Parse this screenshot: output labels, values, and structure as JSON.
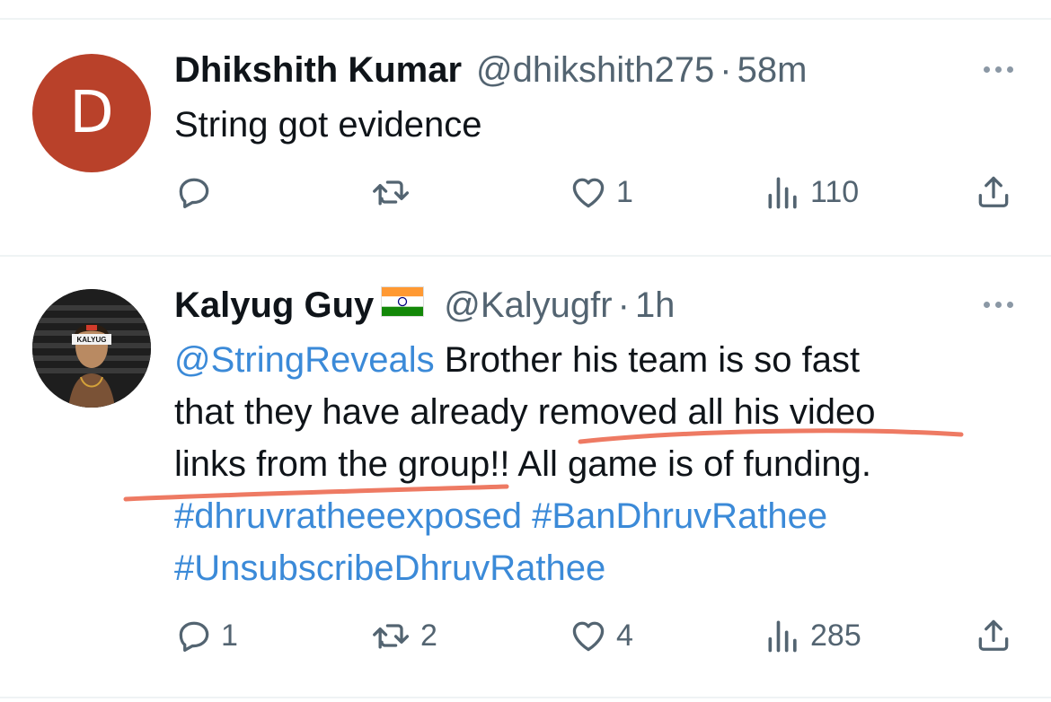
{
  "tweets": [
    {
      "name": "Dhikshith Kumar",
      "handle": "@dhikshith275",
      "separator": "·",
      "time": "58m",
      "avatar_letter": "D",
      "text": "String got evidence",
      "actions": {
        "reply_count": "",
        "retweet_count": "",
        "like_count": "1",
        "view_count": "110"
      }
    },
    {
      "name": "Kalyug Guy",
      "flag": "india-flag",
      "handle": "@Kalyugfr",
      "separator": "·",
      "time": "1h",
      "avatar_text": "KALYUG",
      "mention": "@StringReveals",
      "line1_rest": " Brother his team is so fast",
      "line2": "that they have already removed all his video",
      "line3": "links from the group!! All game is of funding.",
      "hashtags_line1": "#dhruvratheeexposed #BanDhruvRathee",
      "hashtags_line2": "#UnsubscribeDhruvRathee",
      "actions": {
        "reply_count": "1",
        "retweet_count": "2",
        "like_count": "4",
        "view_count": "285"
      }
    }
  ],
  "colors": {
    "accent_link": "#3b8ad8",
    "secondary": "#536471",
    "avatar_bg": "#b9412a",
    "underline": "#ee7a63"
  }
}
